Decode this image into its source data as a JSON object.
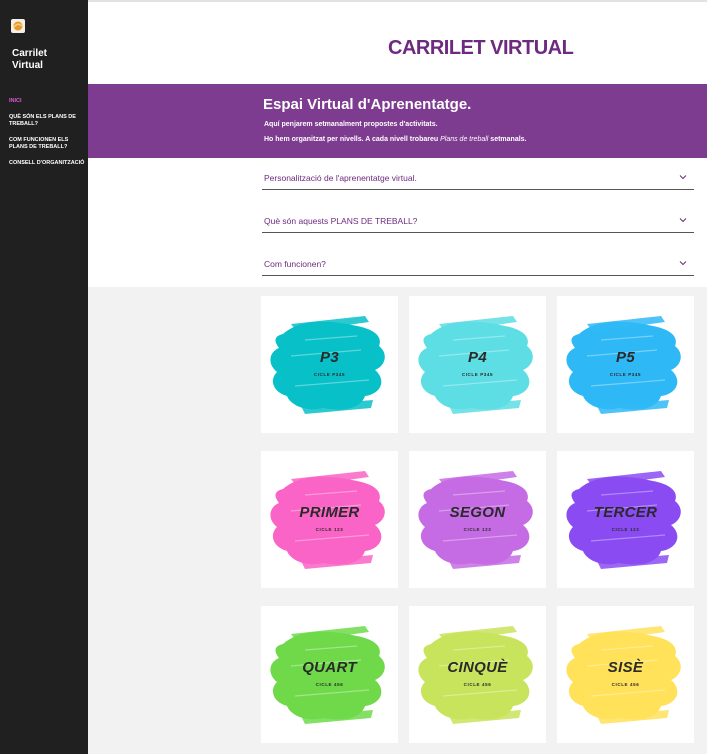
{
  "sidebar": {
    "site_name": "Carrilet Virtual",
    "nav": [
      {
        "label": "Inici",
        "active": true
      },
      {
        "label": "Què són els plans de treball?"
      },
      {
        "label": "Com funcionen els plans de treball?"
      },
      {
        "label": "Consell d'organització"
      }
    ]
  },
  "header": {
    "title": "CARRILET VIRTUAL"
  },
  "banner": {
    "heading": "Espai Virtual d'Aprenentatge.",
    "line1": "Aquí penjarem setmanalment propostes d'activitats.",
    "line2_prefix": "Ho hem organitzat per nivells. A cada nivell trobareu ",
    "line2_em": "Plans de treball",
    "line2_suffix": " setmanals."
  },
  "accordions": [
    {
      "label": "Personalització de l'aprenentatge virtual."
    },
    {
      "label": "Què són aquests PLANS DE TREBALL?"
    },
    {
      "label": "Com funcionen?"
    }
  ],
  "cards": [
    {
      "title": "P3",
      "sub": "CICLE P345",
      "color": "#08c0c8"
    },
    {
      "title": "P4",
      "sub": "CICLE P345",
      "color": "#5ddde4"
    },
    {
      "title": "P5",
      "sub": "CICLE P345",
      "color": "#2fb8f6"
    },
    {
      "title": "PRIMER",
      "sub": "CICLE 123",
      "color": "#f964c6"
    },
    {
      "title": "SEGON",
      "sub": "CICLE 123",
      "color": "#c56be4"
    },
    {
      "title": "TERCER",
      "sub": "CICLE 123",
      "color": "#8a4cf2"
    },
    {
      "title": "QUART",
      "sub": "CICLE 456",
      "color": "#6fd94a"
    },
    {
      "title": "CINQUÈ",
      "sub": "CICLE 456",
      "color": "#c8e35c"
    },
    {
      "title": "SISÈ",
      "sub": "CICLE 456",
      "color": "#ffe15a"
    }
  ],
  "colors": {
    "sidebar": "#202020",
    "accent": "#6d2a7f",
    "banner": "#7d3c8f",
    "active_nav": "#d85bd0"
  }
}
